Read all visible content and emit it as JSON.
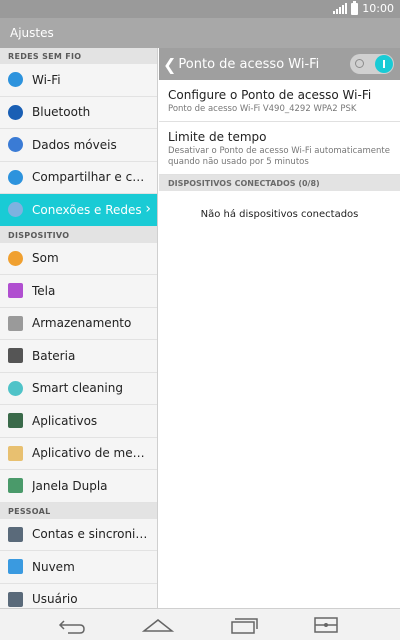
{
  "status_bar": {
    "time": "10:00"
  },
  "app_bar": {
    "title": "Ajustes"
  },
  "sidebar": {
    "sections": [
      {
        "title": "REDES SEM FIO",
        "items": [
          {
            "label": "Wi-Fi",
            "icon": "wifi-icon",
            "color": "#2d93dd"
          },
          {
            "label": "Bluetooth",
            "icon": "bluetooth-icon",
            "color": "#1a5fb4"
          },
          {
            "label": "Dados móveis",
            "icon": "mobile-data-icon",
            "color": "#3a7bd5"
          },
          {
            "label": "Compartilhar e con…",
            "icon": "share-connect-icon",
            "color": "#2d93dd"
          },
          {
            "label": "Conexões e Redes",
            "icon": "networks-icon",
            "color": "#7fb2e0",
            "active": true
          }
        ]
      },
      {
        "title": "DISPOSITIVO",
        "items": [
          {
            "label": "Som",
            "icon": "sound-icon",
            "color": "#f0a030"
          },
          {
            "label": "Tela",
            "icon": "display-icon",
            "color": "#b04fd0"
          },
          {
            "label": "Armazenamento",
            "icon": "storage-icon",
            "color": "#9a9a9a"
          },
          {
            "label": "Bateria",
            "icon": "battery-icon",
            "color": "#555555"
          },
          {
            "label": "Smart cleaning",
            "icon": "smart-cleaning-icon",
            "color": "#4fc3c8"
          },
          {
            "label": "Aplicativos",
            "icon": "apps-icon",
            "color": "#3a6a4a"
          },
          {
            "label": "Aplicativo de mens…",
            "icon": "messaging-app-icon",
            "color": "#e8c070"
          },
          {
            "label": "Janela Dupla",
            "icon": "dual-window-icon",
            "color": "#4a9a6a"
          }
        ]
      },
      {
        "title": "PESSOAL",
        "items": [
          {
            "label": "Contas e sincroniza…",
            "icon": "accounts-sync-icon",
            "color": "#5a6a7a"
          },
          {
            "label": "Nuvem",
            "icon": "cloud-icon",
            "color": "#3a9ae0"
          },
          {
            "label": "Usuário",
            "icon": "user-icon",
            "color": "#5a6a7a"
          }
        ]
      }
    ]
  },
  "panel": {
    "title": "Ponto de acesso Wi-Fi",
    "toggle_on": true,
    "rows": [
      {
        "title": "Configure o Ponto de acesso Wi-Fi",
        "subtitle": "Ponto de acesso Wi-Fi V490_4292 WPA2 PSK"
      },
      {
        "title": "Limite de tempo",
        "subtitle": "Desativar o Ponto de acesso Wi-Fi automaticamente quando não usado por 5 minutos"
      }
    ],
    "section_title": "DISPOSITIVOS CONECTADOS (0/8)",
    "empty_text": "Não há dispositivos conectados"
  },
  "colors": {
    "accent": "#19cbd5",
    "header": "#9f9f9f",
    "appbar": "#a8a8a8"
  }
}
